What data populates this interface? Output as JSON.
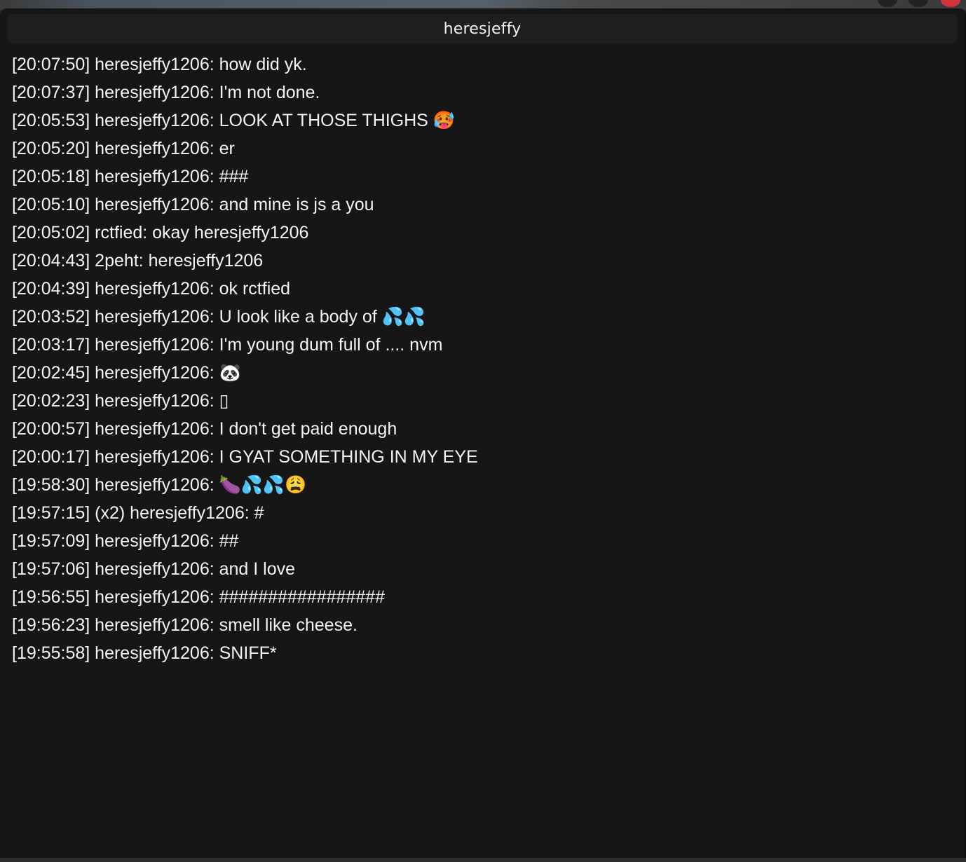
{
  "window": {
    "title": "heresjeffy"
  },
  "messages": [
    {
      "time": "[20:07:50]",
      "author": "heresjeffy1206:",
      "text": "how did yk."
    },
    {
      "time": "[20:07:37]",
      "author": "heresjeffy1206:",
      "text": "I'm not done."
    },
    {
      "time": "[20:05:53]",
      "author": "heresjeffy1206:",
      "text": "LOOK AT THOSE THIGHS 🥵"
    },
    {
      "time": "[20:05:20]",
      "author": "heresjeffy1206:",
      "text": "er"
    },
    {
      "time": "[20:05:18]",
      "author": "heresjeffy1206:",
      "text": "###"
    },
    {
      "time": "[20:05:10]",
      "author": "heresjeffy1206:",
      "text": "and mine is js a you"
    },
    {
      "time": "[20:05:02]",
      "author": "rctfied:",
      "text": "okay heresjeffy1206"
    },
    {
      "time": "[20:04:43]",
      "author": "2peht:",
      "text": "heresjeffy1206"
    },
    {
      "time": "[20:04:39]",
      "author": "heresjeffy1206:",
      "text": "ok rctfied"
    },
    {
      "time": "[20:03:52]",
      "author": "heresjeffy1206:",
      "text": "U look like a body of 💦💦"
    },
    {
      "time": "[20:03:17]",
      "author": "heresjeffy1206:",
      "text": "I'm young dum full of .... nvm"
    },
    {
      "time": "[20:02:45]",
      "author": "heresjeffy1206:",
      "text": "🐼"
    },
    {
      "time": "[20:02:23]",
      "author": "heresjeffy1206:",
      "text": "▯"
    },
    {
      "time": "[20:00:57]",
      "author": "heresjeffy1206:",
      "text": "I don't get paid enough"
    },
    {
      "time": "[20:00:17]",
      "author": "heresjeffy1206:",
      "text": "I GYAT SOMETHING IN MY EYE"
    },
    {
      "time": "[19:58:30]",
      "author": "heresjeffy1206:",
      "text": "🍆💦💦😩"
    },
    {
      "time": "[19:57:15]",
      "author": "(x2) heresjeffy1206:",
      "text": "#"
    },
    {
      "time": "[19:57:09]",
      "author": "heresjeffy1206:",
      "text": "##"
    },
    {
      "time": "[19:57:06]",
      "author": "heresjeffy1206:",
      "text": "and I love"
    },
    {
      "time": "[19:56:55]",
      "author": "heresjeffy1206:",
      "text": "#################"
    },
    {
      "time": "[19:56:23]",
      "author": "heresjeffy1206:",
      "text": "smell like cheese."
    },
    {
      "time": "[19:55:58]",
      "author": "heresjeffy1206:",
      "text": "SNIFF*"
    }
  ]
}
